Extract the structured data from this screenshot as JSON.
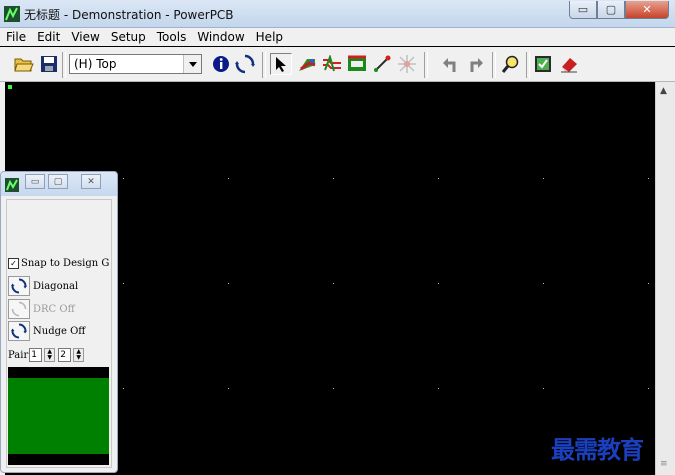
{
  "window": {
    "title": "无标题 - Demonstration - PowerPCB",
    "minimize": "▭",
    "maximize": "▢",
    "close": "✕"
  },
  "menu": [
    "File",
    "Edit",
    "View",
    "Setup",
    "Tools",
    "Window",
    "Help"
  ],
  "toolbar": {
    "layer_value": "(H) Top",
    "icons": [
      "open-icon",
      "save-icon",
      "info-icon",
      "cycle-icon",
      "select-arrow-icon",
      "route-icon",
      "dynamic-route-icon",
      "split-plane-icon",
      "sketch-route-icon",
      "autoroute-icon",
      "undo-icon",
      "redo-icon",
      "zoom-icon",
      "design-verify-icon",
      "eraser-icon"
    ]
  },
  "panel": {
    "snap_label": "Snap to Design G",
    "snap_checked": true,
    "diagonal_label": "Diagonal",
    "drc_label": "DRC Off",
    "nudge_label": "Nudge Off",
    "pair_label": "Pair",
    "pair_value_1": "1",
    "pair_value_2": "2",
    "layer_color": "#008000"
  },
  "colors": {
    "canvas": "#000000",
    "grid": "#bbbbbb",
    "origin": "#33ff33"
  },
  "watermark": "最需教育"
}
